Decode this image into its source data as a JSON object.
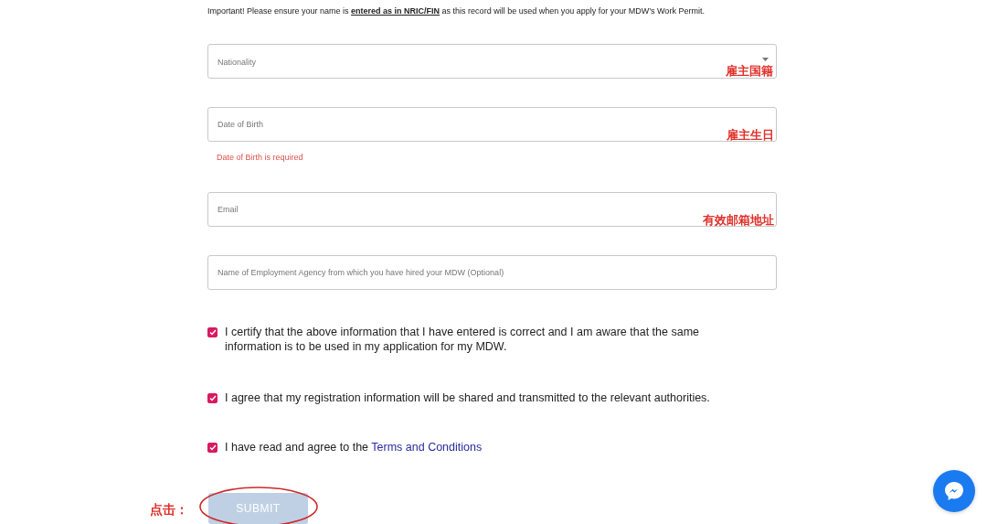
{
  "notice": "Important! Please ensure your name is **entered as in NRIC/FIN** as this record will be used when you apply for your MDW’s Work Permit.",
  "fields": [
    {
      "kind": "select",
      "placeholder": "Nationality",
      "annotation": "雇主国籍"
    },
    {
      "kind": "text",
      "placeholder": "Date of Birth",
      "annotation": "雇主生日",
      "error": "Date of Birth is required"
    },
    {
      "kind": "text",
      "placeholder": "Email",
      "annotation": "有效邮箱地址"
    },
    {
      "kind": "text",
      "placeholder": "Name of Employment Agency from which you have hired your MDW (Optional)"
    }
  ],
  "checkboxes": [
    {
      "label": "I certify that the above information that I have entered is correct and I am aware that the same information is to be used in my application for my MDW.",
      "checked": true
    },
    {
      "label": "I agree that my registration information will be shared and transmitted to the relevant authorities.",
      "checked": true
    },
    {
      "label": "I have read and agree to the",
      "link": "Terms and Conditions",
      "checked": true
    }
  ],
  "submit": {
    "label": "SUBMIT",
    "disabled": true,
    "annotation": "点击："
  }
}
